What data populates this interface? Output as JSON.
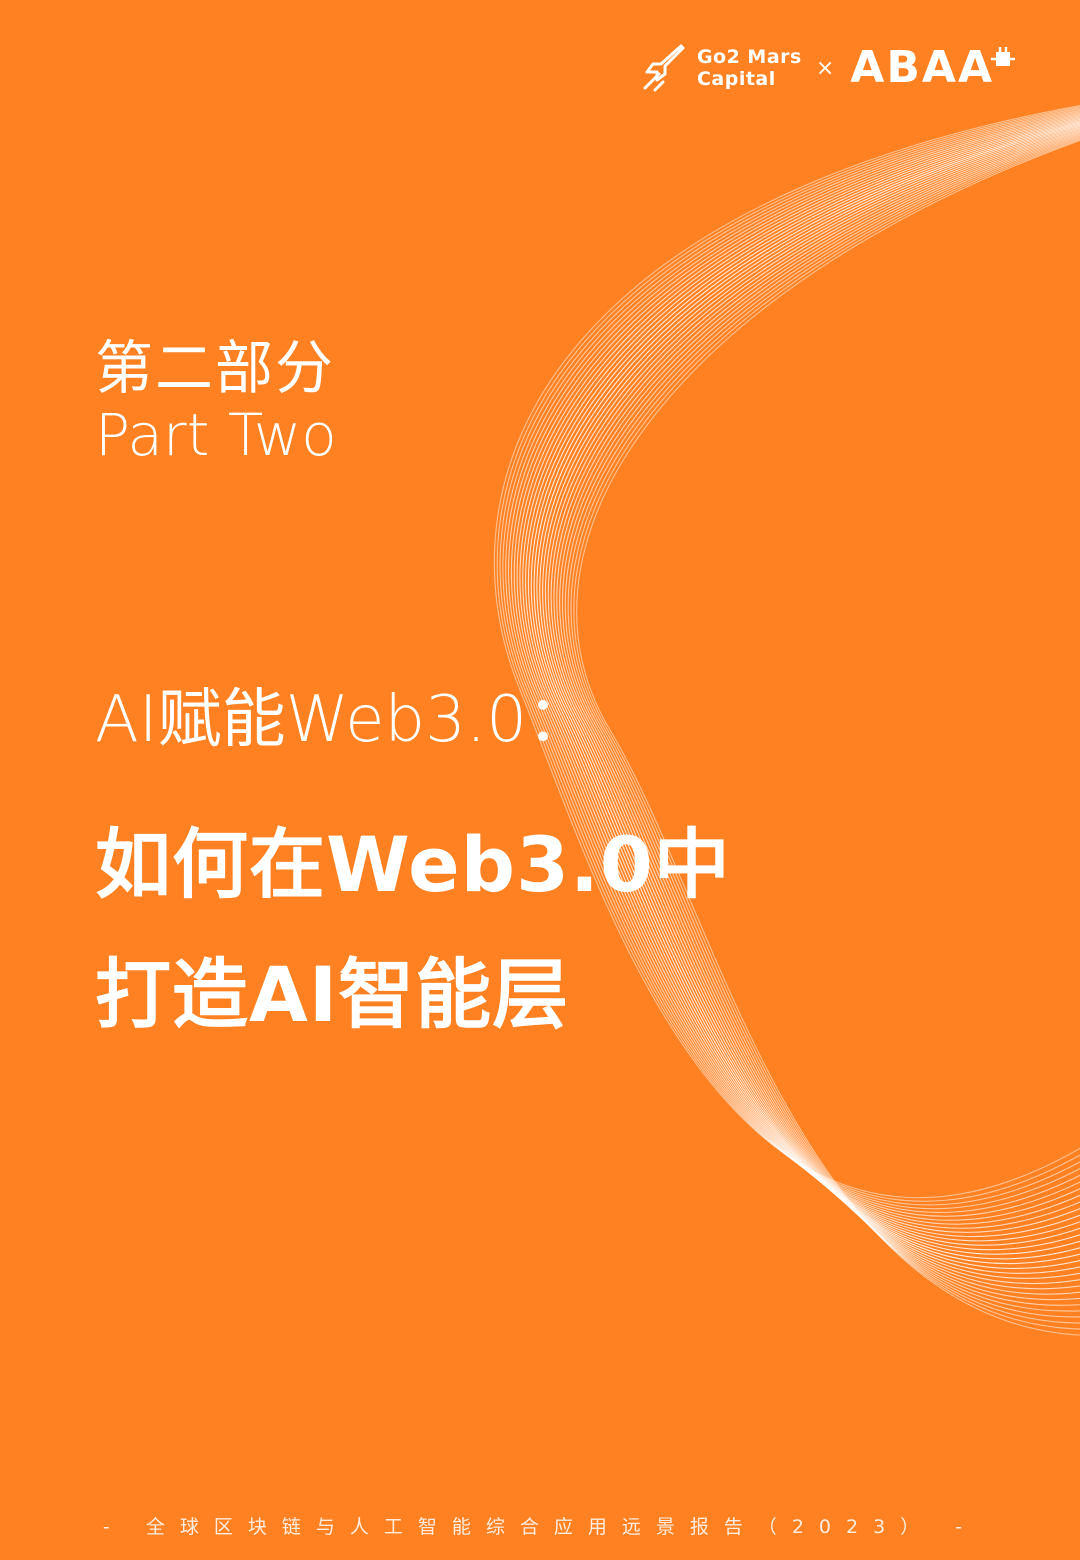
{
  "colors": {
    "background": "#FF8121",
    "foreground": "#FFFFFF"
  },
  "header": {
    "logo_left": {
      "icon": "rocket-icon",
      "line1": "Go2 Mars",
      "line2": "Capital"
    },
    "separator": "×",
    "logo_right": {
      "text": "ABAA",
      "icon": "chip-icon"
    }
  },
  "section": {
    "label_zh": "第二部分",
    "label_en": "Part Two"
  },
  "subtitle": "AI赋能Web3.0：",
  "title": {
    "line1": "如何在Web3.0中",
    "line2": "打造AI智能层"
  },
  "footer": "- 全球区块链与人工智能综合应用远景报告（2023） -"
}
